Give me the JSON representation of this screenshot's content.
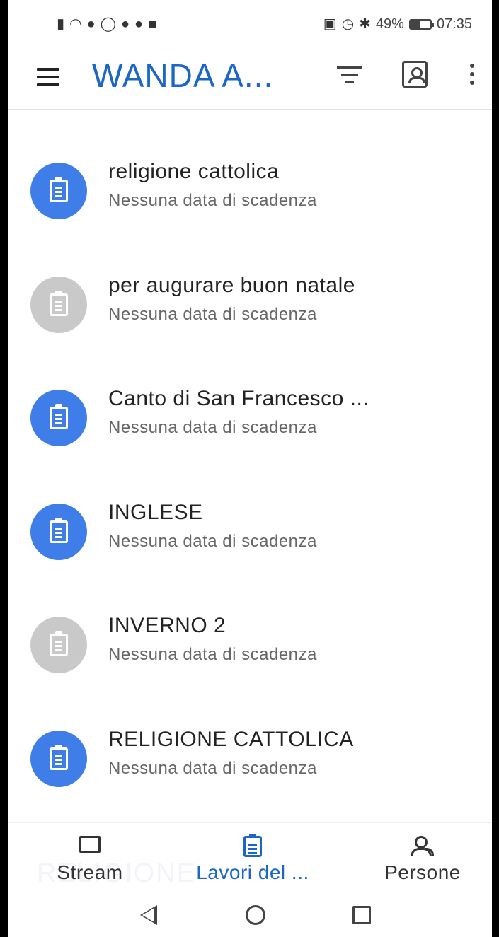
{
  "status_bar": {
    "left_icons": [
      "signal-icon",
      "wifi-icon",
      "app-icon",
      "whatsapp-icon",
      "facebook-icon",
      "facebook-icon",
      "video-icon"
    ],
    "right_icons": [
      "nfc-icon",
      "alarm-icon",
      "bluetooth-icon"
    ],
    "battery": "49%",
    "battery_level": 0.49,
    "time": "07:35"
  },
  "app_bar": {
    "title": "WANDA A..."
  },
  "assignments": [
    {
      "title": "religione cattolica",
      "subtitle": "Nessuna data di scadenza",
      "icon_color": "blue"
    },
    {
      "title": "per augurare buon natale",
      "subtitle": "Nessuna data di scadenza",
      "icon_color": "grey"
    },
    {
      "title": "Canto di San Francesco ...",
      "subtitle": "Nessuna data di scadenza",
      "icon_color": "blue"
    },
    {
      "title": "INGLESE",
      "subtitle": "Nessuna data di scadenza",
      "icon_color": "blue"
    },
    {
      "title": "INVERNO 2",
      "subtitle": "Nessuna data di scadenza",
      "icon_color": "grey"
    },
    {
      "title": "RELIGIONE CATTOLICA",
      "subtitle": "Nessuna data di scadenza",
      "icon_color": "blue"
    }
  ],
  "bottom_nav": {
    "ghost_text": "RELIGIONE",
    "stream": "Stream",
    "lavori": "Lavori del ...",
    "persone": "Persone",
    "active": "lavori"
  },
  "colors": {
    "accent": "#1a66c9",
    "icon_blue": "#3f7ee8",
    "icon_grey": "#c9c9c9"
  }
}
